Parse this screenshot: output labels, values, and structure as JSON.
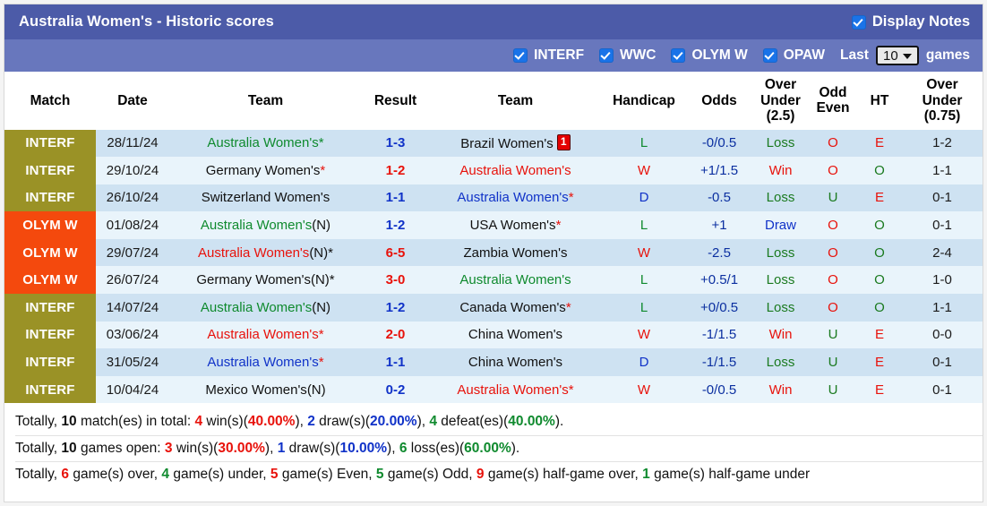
{
  "header": {
    "title": "Australia Women's - Historic scores",
    "display_notes_label": "Display Notes",
    "display_notes_checked": true,
    "accent_color": "#4c5ba8"
  },
  "filters": {
    "competitions": [
      {
        "label": "INTERF",
        "checked": true
      },
      {
        "label": "WWC",
        "checked": true
      },
      {
        "label": "OLYM W",
        "checked": true
      },
      {
        "label": "OPAW",
        "checked": true
      }
    ],
    "last_label": "Last",
    "last_value": "10",
    "games_label": "games"
  },
  "table": {
    "columns": [
      "Match",
      "Date",
      "Team",
      "Result",
      "Team",
      "Handicap",
      "Odds",
      "Over Under (2.5)",
      "Odd Even",
      "HT",
      "Over Under (0.75)"
    ],
    "columns_multiline": [
      {
        "l1": "Match",
        "l2": "",
        "l3": ""
      },
      {
        "l1": "Date",
        "l2": "",
        "l3": ""
      },
      {
        "l1": "Team",
        "l2": "",
        "l3": ""
      },
      {
        "l1": "Result",
        "l2": "",
        "l3": ""
      },
      {
        "l1": "Team",
        "l2": "",
        "l3": ""
      },
      {
        "l1": "Handicap",
        "l2": "",
        "l3": ""
      },
      {
        "l1": "Odds",
        "l2": "",
        "l3": ""
      },
      {
        "l1": "Over",
        "l2": "Under",
        "l3": "(2.5)"
      },
      {
        "l1": "Odd",
        "l2": "Even",
        "l3": ""
      },
      {
        "l1": "HT",
        "l2": "",
        "l3": ""
      },
      {
        "l1": "Over",
        "l2": "Under",
        "l3": "(0.75)"
      }
    ],
    "rows": [
      {
        "comp": "INTERF",
        "comp_class": "comp-INTERF",
        "date": "28/11/24",
        "home": "Australia Women's",
        "home_color": "green",
        "home_suffix": "*",
        "home_suffix_color": "star-green",
        "score": "1-3",
        "score_color": "blue",
        "away": "Brazil Women's",
        "away_color": "black",
        "away_suffix": "",
        "away_suffix_color": "black",
        "away_card": "1",
        "wld": "L",
        "wld_color": "green",
        "handicap": "-0/0.5",
        "odds": "Loss",
        "odds_color": "dgreen",
        "ou25": "O",
        "ou25_color": "red",
        "oe": "E",
        "oe_color": "red",
        "ht": "1-2",
        "ou075": "O",
        "ou075_color": "red"
      },
      {
        "comp": "INTERF",
        "comp_class": "comp-INTERF",
        "date": "29/10/24",
        "home": "Germany Women's",
        "home_color": "black",
        "home_suffix": "*",
        "home_suffix_color": "star-red",
        "score": "1-2",
        "score_color": "red",
        "away": "Australia Women's",
        "away_color": "red",
        "away_suffix": "",
        "away_suffix_color": "black",
        "away_card": "",
        "wld": "W",
        "wld_color": "red",
        "handicap": "+1/1.5",
        "odds": "Win",
        "odds_color": "red",
        "ou25": "O",
        "ou25_color": "red",
        "oe": "O",
        "oe_color": "dgreen",
        "ht": "1-1",
        "ou075": "O",
        "ou075_color": "red"
      },
      {
        "comp": "INTERF",
        "comp_class": "comp-INTERF",
        "date": "26/10/24",
        "home": "Switzerland Women's",
        "home_color": "black",
        "home_suffix": "",
        "home_suffix_color": "black",
        "score": "1-1",
        "score_color": "blue",
        "away": "Australia Women's",
        "away_color": "blue",
        "away_suffix": "*",
        "away_suffix_color": "star-red",
        "away_card": "",
        "wld": "D",
        "wld_color": "blue",
        "handicap": "-0.5",
        "odds": "Loss",
        "odds_color": "dgreen",
        "ou25": "U",
        "ou25_color": "dgreen",
        "oe": "E",
        "oe_color": "red",
        "ht": "0-1",
        "ou075": "O",
        "ou075_color": "red"
      },
      {
        "comp": "OLYM W",
        "comp_class": "comp-OLYMW",
        "date": "01/08/24",
        "home": "Australia Women's",
        "home_color": "green",
        "home_suffix": "(N)",
        "home_suffix_color": "suffix-black",
        "score": "1-2",
        "score_color": "blue",
        "away": "USA Women's",
        "away_color": "black",
        "away_suffix": "*",
        "away_suffix_color": "star-red",
        "away_card": "",
        "wld": "L",
        "wld_color": "green",
        "handicap": "+1",
        "odds": "Draw",
        "odds_color": "blue",
        "ou25": "O",
        "ou25_color": "red",
        "oe": "O",
        "oe_color": "dgreen",
        "ht": "0-1",
        "ou075": "O",
        "ou075_color": "red"
      },
      {
        "comp": "OLYM W",
        "comp_class": "comp-OLYMW",
        "date": "29/07/24",
        "home": "Australia Women's",
        "home_color": "red",
        "home_suffix": "(N)*",
        "home_suffix_color": "suffix-black",
        "score": "6-5",
        "score_color": "red",
        "away": "Zambia Women's",
        "away_color": "black",
        "away_suffix": "",
        "away_suffix_color": "black",
        "away_card": "",
        "wld": "W",
        "wld_color": "red",
        "handicap": "-2.5",
        "odds": "Loss",
        "odds_color": "dgreen",
        "ou25": "O",
        "ou25_color": "red",
        "oe": "O",
        "oe_color": "dgreen",
        "ht": "2-4",
        "ou075": "O",
        "ou075_color": "red"
      },
      {
        "comp": "OLYM W",
        "comp_class": "comp-OLYMW",
        "date": "26/07/24",
        "home": "Germany Women's",
        "home_color": "black",
        "home_suffix": "(N)*",
        "home_suffix_color": "suffix-black",
        "score": "3-0",
        "score_color": "red",
        "away": "Australia Women's",
        "away_color": "green",
        "away_suffix": "",
        "away_suffix_color": "black",
        "away_card": "",
        "wld": "L",
        "wld_color": "green",
        "handicap": "+0.5/1",
        "odds": "Loss",
        "odds_color": "dgreen",
        "ou25": "O",
        "ou25_color": "red",
        "oe": "O",
        "oe_color": "dgreen",
        "ht": "1-0",
        "ou075": "O",
        "ou075_color": "red"
      },
      {
        "comp": "INTERF",
        "comp_class": "comp-INTERF",
        "date": "14/07/24",
        "home": "Australia Women's",
        "home_color": "green",
        "home_suffix": "(N)",
        "home_suffix_color": "suffix-black",
        "score": "1-2",
        "score_color": "blue",
        "away": "Canada Women's",
        "away_color": "black",
        "away_suffix": "*",
        "away_suffix_color": "star-red",
        "away_card": "",
        "wld": "L",
        "wld_color": "green",
        "handicap": "+0/0.5",
        "odds": "Loss",
        "odds_color": "dgreen",
        "ou25": "O",
        "ou25_color": "red",
        "oe": "O",
        "oe_color": "dgreen",
        "ht": "1-1",
        "ou075": "O",
        "ou075_color": "red"
      },
      {
        "comp": "INTERF",
        "comp_class": "comp-INTERF",
        "date": "03/06/24",
        "home": "Australia Women's",
        "home_color": "red",
        "home_suffix": "*",
        "home_suffix_color": "star-red",
        "score": "2-0",
        "score_color": "red",
        "away": "China Women's",
        "away_color": "black",
        "away_suffix": "",
        "away_suffix_color": "black",
        "away_card": "",
        "wld": "W",
        "wld_color": "red",
        "handicap": "-1/1.5",
        "odds": "Win",
        "odds_color": "red",
        "ou25": "U",
        "ou25_color": "dgreen",
        "oe": "E",
        "oe_color": "red",
        "ht": "0-0",
        "ou075": "U",
        "ou075_color": "dgreen"
      },
      {
        "comp": "INTERF",
        "comp_class": "comp-INTERF",
        "date": "31/05/24",
        "home": "Australia Women's",
        "home_color": "blue",
        "home_suffix": "*",
        "home_suffix_color": "star-red",
        "score": "1-1",
        "score_color": "blue",
        "away": "China Women's",
        "away_color": "black",
        "away_suffix": "",
        "away_suffix_color": "black",
        "away_card": "",
        "wld": "D",
        "wld_color": "blue",
        "handicap": "-1/1.5",
        "odds": "Loss",
        "odds_color": "dgreen",
        "ou25": "U",
        "ou25_color": "dgreen",
        "oe": "E",
        "oe_color": "red",
        "ht": "0-1",
        "ou075": "O",
        "ou075_color": "red"
      },
      {
        "comp": "INTERF",
        "comp_class": "comp-INTERF",
        "date": "10/04/24",
        "home": "Mexico Women's",
        "home_color": "black",
        "home_suffix": "(N)",
        "home_suffix_color": "suffix-black",
        "score": "0-2",
        "score_color": "blue",
        "away": "Australia Women's",
        "away_color": "red",
        "away_suffix": "*",
        "away_suffix_color": "star-red",
        "away_card": "",
        "wld": "W",
        "wld_color": "red",
        "handicap": "-0/0.5",
        "odds": "Win",
        "odds_color": "red",
        "ou25": "U",
        "ou25_color": "dgreen",
        "oe": "E",
        "oe_color": "red",
        "ht": "0-1",
        "ou075": "O",
        "ou075_color": "red"
      }
    ]
  },
  "summary": {
    "line1": {
      "p1": "Totally, ",
      "n_total": "10",
      "p2": " match(es) in total: ",
      "wins": "4",
      "p3": " win(s)(",
      "wins_pct": "40.00%",
      "p4": "), ",
      "draws": "2",
      "p5": " draw(s)(",
      "draws_pct": "20.00%",
      "p6": "), ",
      "defeats": "4",
      "p7": " defeat(es)(",
      "defeats_pct": "40.00%",
      "p8": ")."
    },
    "line2": {
      "p1": "Totally, ",
      "n_total": "10",
      "p2": " games open: ",
      "wins": "3",
      "p3": " win(s)(",
      "wins_pct": "30.00%",
      "p4": "), ",
      "draws": "1",
      "p5": " draw(s)(",
      "draws_pct": "10.00%",
      "p6": "), ",
      "losses": "6",
      "p7": " loss(es)(",
      "losses_pct": "60.00%",
      "p8": ")."
    },
    "line3": {
      "p1": "Totally, ",
      "over": "6",
      "p2": " game(s) over, ",
      "under": "4",
      "p3": " game(s) under, ",
      "even": "5",
      "p4": " game(s) Even, ",
      "odd": "5",
      "p5": " game(s) Odd, ",
      "half_over": "9",
      "p6": " game(s) half-game over, ",
      "half_under": "1",
      "p7": " game(s) half-game under"
    }
  }
}
